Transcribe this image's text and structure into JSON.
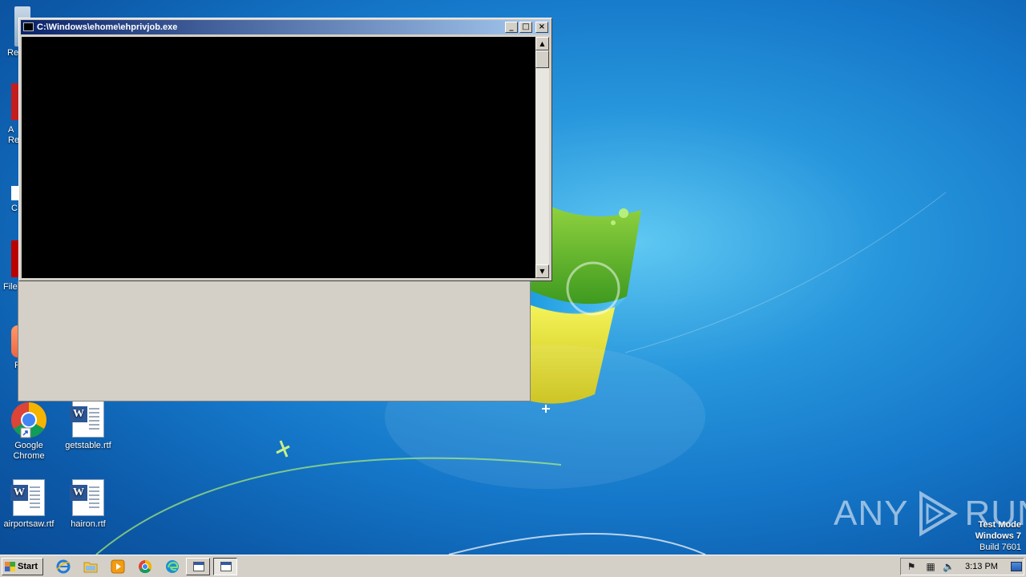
{
  "desktop": {
    "icons": [
      {
        "label": "Google Chrome",
        "type": "chrome"
      },
      {
        "label": "getstable.rtf",
        "type": "rtf"
      },
      {
        "label": "airportsaw.rtf",
        "type": "rtf"
      },
      {
        "label": "hairon.rtf",
        "type": "rtf"
      }
    ],
    "partial_icons": [
      "Re",
      "A Re",
      "C",
      "File",
      "F"
    ]
  },
  "console_window": {
    "title": "C:\\Windows\\ehome\\ehprivjob.exe",
    "buttons": {
      "minimize": "_",
      "maximize": "□",
      "close": "×"
    },
    "scroll_up": "▲",
    "scroll_down": "▼"
  },
  "watermark": {
    "text_left": "ANY",
    "text_right": "RUN"
  },
  "test_mode": {
    "line1": "Test Mode",
    "line2": "Windows 7",
    "line3": "Build 7601"
  },
  "taskbar": {
    "start_label": "Start",
    "quick_launch": [
      "ie-icon",
      "folder-icon",
      "media-player-icon",
      "chrome-icon",
      "edge-icon"
    ],
    "clock": "3:13 PM"
  },
  "colors": {
    "desktop_bg": "#1577c9",
    "titlebar": "#0a246a",
    "window_bg": "#d4d0c8"
  }
}
